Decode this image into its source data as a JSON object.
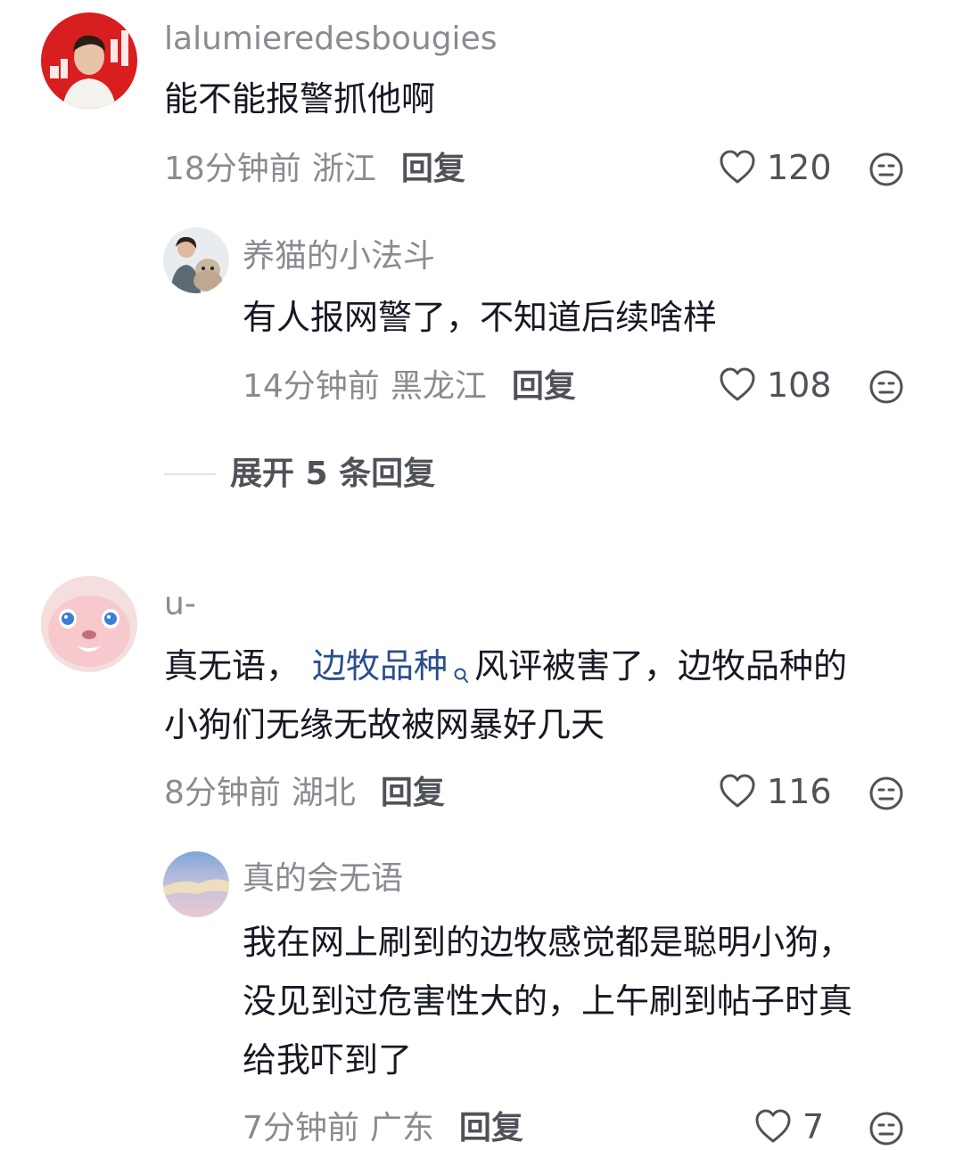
{
  "comments": [
    {
      "username": "lalumieredesbougies",
      "text_lines": [
        "能不能报警抓他啊"
      ],
      "time": "18分钟前",
      "location": "浙江",
      "reply_label": "回复",
      "likes": "120",
      "avatar_icon": "portrait-red-background",
      "replies": [
        {
          "username": "养猫的小法斗",
          "text_lines": [
            "有人报网警了，不知道后续啥样"
          ],
          "time": "14分钟前",
          "location": "黑龙江",
          "reply_label": "回复",
          "likes": "108",
          "avatar_icon": "person-with-dog"
        }
      ],
      "expand_label": "展开 5 条回复"
    },
    {
      "username": "u-",
      "text_parts": {
        "prefix": "真无语，",
        "link": "边牧品种",
        "suffix": "风评被害了，边牧品种的"
      },
      "text_line2": "小狗们无缘无故被网暴好几天",
      "time": "8分钟前",
      "location": "湖北",
      "reply_label": "回复",
      "likes": "116",
      "avatar_icon": "pink-plush-bunny",
      "replies": [
        {
          "username": "真的会无语",
          "text_lines": [
            "我在网上刷到的边牧感觉都是聪明小狗，",
            "没见到过危害性大的，上午刷到帖子时真",
            "给我吓到了"
          ],
          "time": "7分钟前",
          "location": "广东",
          "reply_label": "回复",
          "likes": "7",
          "avatar_icon": "sky-cloud"
        }
      ]
    }
  ],
  "icons": {
    "like": "heart-outline-icon",
    "dislike": "neutral-face-icon",
    "search_link": "search-icon"
  },
  "colors": {
    "text_primary": "#161823",
    "text_secondary": "#8a8b91",
    "link": "#2b4f8c"
  }
}
